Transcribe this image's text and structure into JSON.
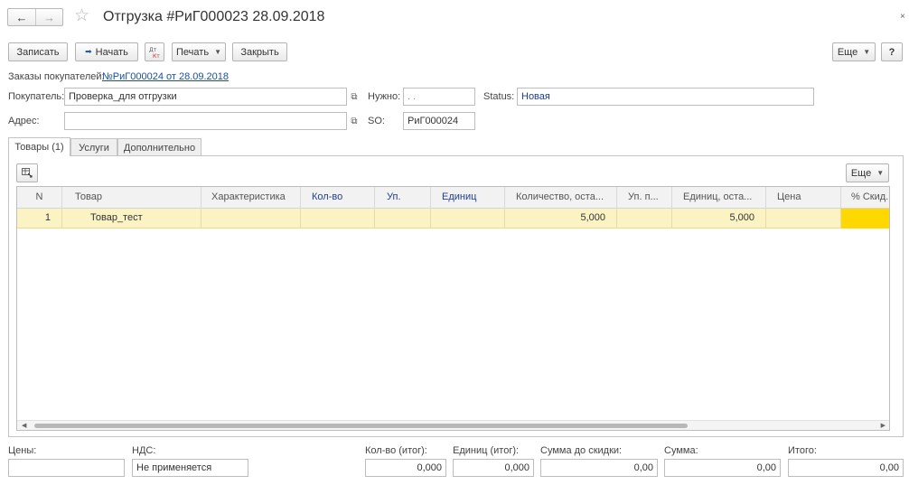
{
  "window": {
    "title": "Отгрузка #РиГ000023 28.09.2018",
    "nav_back": "←",
    "nav_forward": "→",
    "star": "☆",
    "close": "×"
  },
  "toolbar": {
    "save_label": "Записать",
    "start_label": "Начать",
    "dt_kt_glyph": "Дт/Кт",
    "print_label": "Печать",
    "close_label": "Закрыть",
    "more_label": "Еще",
    "help_label": "?"
  },
  "orders": {
    "label": "Заказы покупателей:",
    "link": "№РиГ000024 от 28.09.2018"
  },
  "form": {
    "buyer_label": "Покупатель:",
    "buyer_value": "Проверка_для отгрузки",
    "needed_label": "Нужно:",
    "needed_value": ".  .",
    "status_label": "Status:",
    "status_value": "Новая",
    "address_label": "Адрес:",
    "address_value": "",
    "so_label": "SO:",
    "so_value": "РиГ000024"
  },
  "tabs": [
    {
      "label": "Товары (1)",
      "active": true
    },
    {
      "label": "Услуги",
      "active": false
    },
    {
      "label": "Дополнительно",
      "active": false
    }
  ],
  "table": {
    "more_label": "Еще",
    "columns": [
      "N",
      "Товар",
      "Характеристика",
      "Кол-во",
      "Уп.",
      "Единиц",
      "Количество, оста...",
      "Уп. п...",
      "Единиц, оста...",
      "Цена",
      "% Скид..."
    ],
    "rows": [
      [
        "1",
        "Товар_тест",
        "",
        "",
        "",
        "",
        "5,000",
        "",
        "5,000",
        "",
        ""
      ]
    ]
  },
  "totals": {
    "prices_label": "Цены:",
    "prices_value": "",
    "vat_label": "НДС:",
    "vat_value": "Не применяется",
    "qty_label": "Кол-во (итог):",
    "qty_value": "0,000",
    "units_label": "Единиц (итог):",
    "units_value": "0,000",
    "before_discount_label": "Сумма до скидки:",
    "before_discount_value": "0,00",
    "sum_label": "Сумма:",
    "sum_value": "0,00",
    "total_label": "Итого:",
    "total_value": "0,00"
  },
  "colors": {
    "selected_row": "#fbf3c4",
    "highlight_cell": "#ffd800",
    "link": "#1a4fa0"
  }
}
